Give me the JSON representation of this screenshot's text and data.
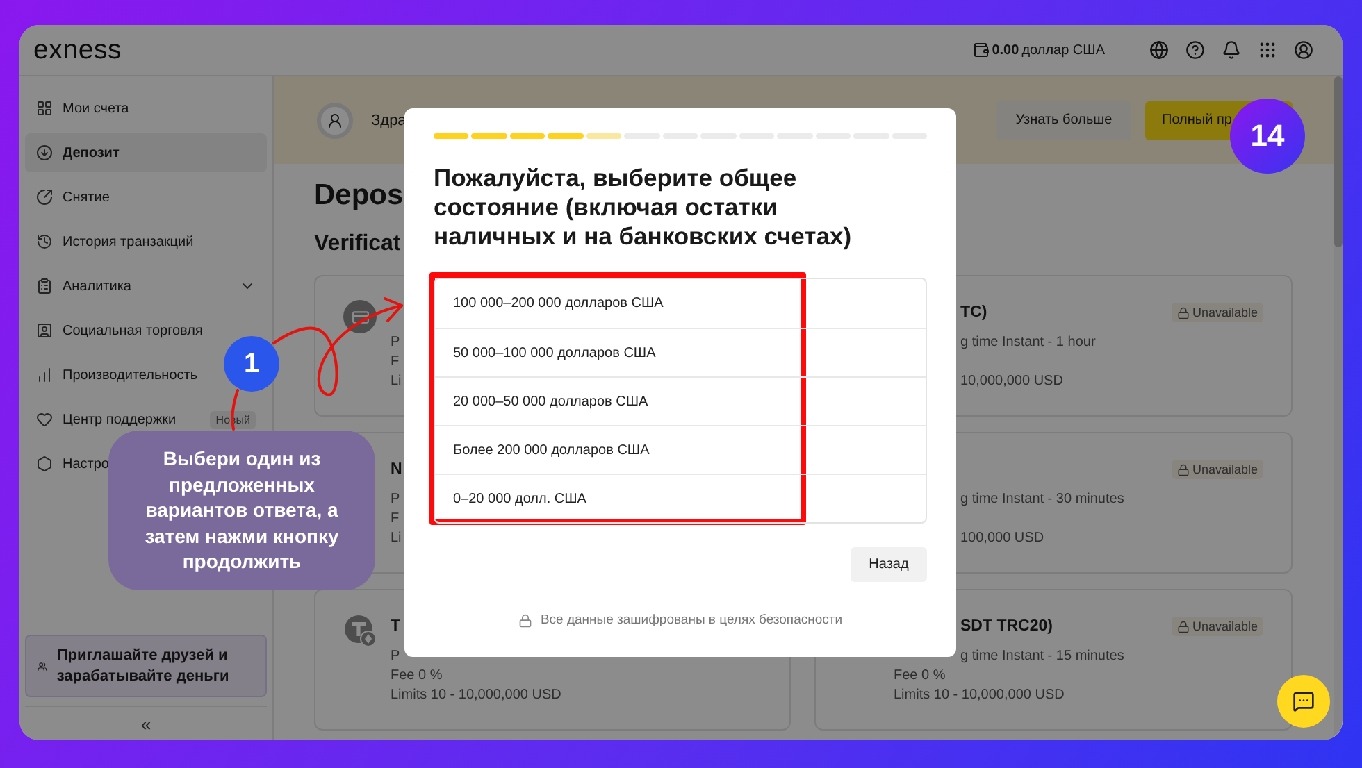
{
  "header": {
    "logo": "exness",
    "balance_amount": "0.00",
    "balance_currency": "доллар США"
  },
  "sidebar": {
    "items": [
      {
        "label": "Мои счета",
        "kind": "link",
        "selected": false
      },
      {
        "label": "Депозит",
        "kind": "link",
        "selected": true
      },
      {
        "label": "Снятие",
        "kind": "link",
        "selected": false
      },
      {
        "label": "История транзакций",
        "kind": "link",
        "selected": false
      },
      {
        "label": "Аналитика",
        "kind": "group",
        "selected": false
      },
      {
        "label": "Социальная торговля",
        "kind": "link",
        "selected": false
      },
      {
        "label": "Производительность",
        "kind": "link",
        "selected": false
      },
      {
        "label": "Центр поддержки",
        "kind": "link",
        "selected": false,
        "badge": "Новый"
      },
      {
        "label": "Настро",
        "kind": "link",
        "selected": false
      }
    ],
    "invite": "Приглашайте друзей и зарабатывайте деньги",
    "collapse": "«"
  },
  "banner": {
    "greeting": "Здра",
    "buttons": [
      {
        "label": "Узнать больше",
        "kind": "secondary"
      },
      {
        "label": "Полный пр",
        "kind": "primary"
      }
    ]
  },
  "page": {
    "title": "Depos",
    "subtitle": "Verificat"
  },
  "cards_left": [
    {
      "lines": [
        {
          "text": "P"
        },
        {
          "text": "F"
        },
        {
          "text": "Li"
        }
      ]
    },
    {
      "title": "N",
      "lines": [
        {
          "text": "P"
        },
        {
          "text": "F"
        },
        {
          "text": "Li"
        }
      ]
    },
    {
      "title": "T",
      "lines": [
        {
          "text": "P"
        },
        {
          "text": "Fee 0 %"
        },
        {
          "text": "Limits 10 - 10,000,000 USD"
        }
      ]
    }
  ],
  "cards_right": [
    {
      "title": "TC)",
      "status": "Unavailable",
      "lines": [
        {
          "text": "g time Instant - 1 hour"
        },
        {
          "text": "10,000,000 USD"
        }
      ]
    },
    {
      "status": "Unavailable",
      "lines": [
        {
          "text": "g time Instant - 30 minutes"
        },
        {
          "text": "100,000 USD"
        }
      ]
    },
    {
      "title": "SDT TRC20)",
      "status": "Unavailable",
      "lines": [
        {
          "text": "g time Instant - 15 minutes"
        },
        {
          "text": "Fee 0 %"
        },
        {
          "text": "Limits 10 - 10,000,000 USD"
        }
      ]
    }
  ],
  "modal": {
    "progress": {
      "level": 0.346
    },
    "title": "Пожалуйста, выберите общее состояние (включая остатки наличных и на банковских счетах)",
    "options": [
      "100 000–200 000 долларов США",
      "50 000–100 000 долларов США",
      "20 000–50 000 долларов США",
      "Более 200 000 долларов США",
      "0–20 000 долл. США"
    ],
    "back_button": "Назад",
    "security_note": "Все данные зашифрованы в целях безопасности"
  },
  "tutorial": {
    "step_badge": "14",
    "marker": "1",
    "hint": "Выбери один из предложенных вариантов ответа, а затем нажми кнопку продолжить"
  }
}
